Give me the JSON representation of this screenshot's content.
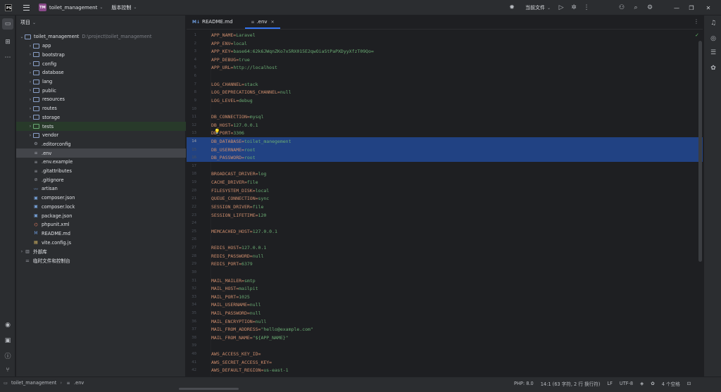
{
  "titlebar": {
    "app_logo": "PS",
    "project_badge": "TM",
    "project_name": "toilet_management",
    "vcs_label": "版本控制",
    "run_config": "当前文件"
  },
  "project_panel": {
    "title": "项目",
    "root_name": "toilet_management",
    "root_path": "D:\\project\\toilet_management",
    "items": [
      {
        "label": "app",
        "type": "folder"
      },
      {
        "label": "bootstrap",
        "type": "folder"
      },
      {
        "label": "config",
        "type": "folder"
      },
      {
        "label": "database",
        "type": "folder"
      },
      {
        "label": "lang",
        "type": "folder"
      },
      {
        "label": "public",
        "type": "folder"
      },
      {
        "label": "resources",
        "type": "folder"
      },
      {
        "label": "routes",
        "type": "folder"
      },
      {
        "label": "storage",
        "type": "folder"
      },
      {
        "label": "tests",
        "type": "folder-green"
      },
      {
        "label": "vendor",
        "type": "folder"
      },
      {
        "label": ".editorconfig",
        "type": "gear"
      },
      {
        "label": ".env",
        "type": "lines"
      },
      {
        "label": ".env.example",
        "type": "lines"
      },
      {
        "label": ".gitattributes",
        "type": "lines"
      },
      {
        "label": ".gitignore",
        "type": "ignore"
      },
      {
        "label": "artisan",
        "type": "artisan"
      },
      {
        "label": "composer.json",
        "type": "json"
      },
      {
        "label": "composer.lock",
        "type": "json"
      },
      {
        "label": "package.json",
        "type": "json"
      },
      {
        "label": "phpunit.xml",
        "type": "xml"
      },
      {
        "label": "README.md",
        "type": "md"
      },
      {
        "label": "vite.config.js",
        "type": "js"
      }
    ],
    "external_libs": "外部库",
    "scratches": "临时文件和控制台"
  },
  "editor": {
    "tabs": [
      {
        "label": "README.md",
        "icon": "M↓"
      },
      {
        "label": ".env",
        "icon": "≡"
      }
    ],
    "lines": [
      {
        "n": "1",
        "key": "APP_NAME",
        "val": "Laravel"
      },
      {
        "n": "2",
        "key": "APP_ENV",
        "val": "local"
      },
      {
        "n": "3",
        "key": "APP_KEY",
        "val": "base64:62k6JWqnZKo7x5RX015E2qwOiaStPaPXDyyXfzT09Qo="
      },
      {
        "n": "4",
        "key": "APP_DEBUG",
        "val": "true"
      },
      {
        "n": "5",
        "key": "APP_URL",
        "val": "http://localhost"
      },
      {
        "n": "6",
        "key": "",
        "val": ""
      },
      {
        "n": "7",
        "key": "LOG_CHANNEL",
        "val": "stack"
      },
      {
        "n": "8",
        "key": "LOG_DEPRECATIONS_CHANNEL",
        "val": "null"
      },
      {
        "n": "9",
        "key": "LOG_LEVEL",
        "val": "debug"
      },
      {
        "n": "10",
        "key": "",
        "val": ""
      },
      {
        "n": "11",
        "key": "DB_CONNECTION",
        "val": "mysql"
      },
      {
        "n": "12",
        "key": "DB_HOST",
        "val": "127.0.0.1"
      },
      {
        "n": "13",
        "key": "DB_PORT",
        "val": "3306"
      },
      {
        "n": "14",
        "key": "DB_DATABASE",
        "val": "toilet_manegement"
      },
      {
        "n": "15",
        "key": "DB_USERNAME",
        "val": "root"
      },
      {
        "n": "16",
        "key": "DB_PASSWORD",
        "val": "root"
      },
      {
        "n": "17",
        "key": "",
        "val": ""
      },
      {
        "n": "18",
        "key": "BROADCAST_DRIVER",
        "val": "log"
      },
      {
        "n": "19",
        "key": "CACHE_DRIVER",
        "val": "file"
      },
      {
        "n": "20",
        "key": "FILESYSTEM_DISK",
        "val": "local"
      },
      {
        "n": "21",
        "key": "QUEUE_CONNECTION",
        "val": "sync"
      },
      {
        "n": "22",
        "key": "SESSION_DRIVER",
        "val": "file"
      },
      {
        "n": "23",
        "key": "SESSION_LIFETIME",
        "val": "120"
      },
      {
        "n": "24",
        "key": "",
        "val": ""
      },
      {
        "n": "25",
        "key": "MEMCACHED_HOST",
        "val": "127.0.0.1"
      },
      {
        "n": "26",
        "key": "",
        "val": ""
      },
      {
        "n": "27",
        "key": "REDIS_HOST",
        "val": "127.0.0.1"
      },
      {
        "n": "28",
        "key": "REDIS_PASSWORD",
        "val": "null"
      },
      {
        "n": "29",
        "key": "REDIS_PORT",
        "val": "6379"
      },
      {
        "n": "30",
        "key": "",
        "val": ""
      },
      {
        "n": "31",
        "key": "MAIL_MAILER",
        "val": "smtp"
      },
      {
        "n": "32",
        "key": "MAIL_HOST",
        "val": "mailpit"
      },
      {
        "n": "33",
        "key": "MAIL_PORT",
        "val": "1025"
      },
      {
        "n": "34",
        "key": "MAIL_USERNAME",
        "val": "null"
      },
      {
        "n": "35",
        "key": "MAIL_PASSWORD",
        "val": "null"
      },
      {
        "n": "36",
        "key": "MAIL_ENCRYPTION",
        "val": "null"
      },
      {
        "n": "37",
        "key": "MAIL_FROM_ADDRESS",
        "val": "\"hello@example.com\""
      },
      {
        "n": "38",
        "key": "MAIL_FROM_NAME",
        "val": "\"${APP_NAME}\""
      },
      {
        "n": "39",
        "key": "",
        "val": ""
      },
      {
        "n": "40",
        "key": "AWS_ACCESS_KEY_ID",
        "val": ""
      },
      {
        "n": "41",
        "key": "AWS_SECRET_ACCESS_KEY",
        "val": ""
      },
      {
        "n": "42",
        "key": "AWS_DEFAULT_REGION",
        "val": "us-east-1"
      }
    ],
    "highlighted_lines": [
      "14",
      "15",
      "16"
    ],
    "current_line": "14"
  },
  "statusbar": {
    "breadcrumb_root": "toilet_management",
    "breadcrumb_file": ".env",
    "php": "PHP: 8.0",
    "position": "14:1 (63 字符, 2 行 换行符)",
    "line_sep": "LF",
    "encoding": "UTF-8",
    "indent": "4 个空格"
  },
  "colors": {
    "key": "#cf8e6d",
    "value": "#6aab73",
    "selection": "#214283",
    "accent": "#3574f0"
  }
}
